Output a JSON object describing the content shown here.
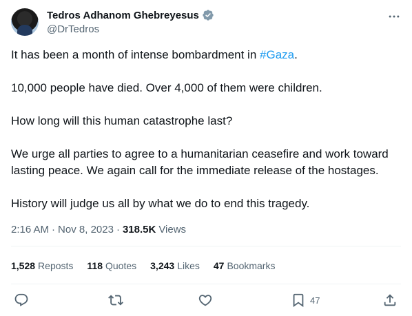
{
  "author": {
    "name": "Tedros Adhanom Ghebreyesus",
    "handle": "@DrTedros"
  },
  "post": {
    "p1_pre": "It has been a month of intense bombardment in ",
    "p1_hashtag": "#Gaza",
    "p1_post": ".",
    "p2": "10,000 people have died. Over 4,000 of them were children.",
    "p3": "How long will this human catastrophe last?",
    "p4": "We urge all parties to agree to a humanitarian ceasefire and work toward lasting peace. We again call for the immediate release of the hostages.",
    "p5": "History will judge us all by what we do to end this tragedy."
  },
  "meta": {
    "time": "2:16 AM",
    "separator": "·",
    "date": "Nov 8, 2023",
    "views_count": "318.5K",
    "views_label": "Views"
  },
  "stats": {
    "reposts_count": "1,528",
    "reposts_label": "Reposts",
    "quotes_count": "118",
    "quotes_label": "Quotes",
    "likes_count": "3,243",
    "likes_label": "Likes",
    "bookmarks_count": "47",
    "bookmarks_label": "Bookmarks"
  },
  "actions": {
    "bookmark_count": "47"
  },
  "colors": {
    "accent": "#1d9bf0",
    "text": "#0f1419",
    "secondary": "#536471",
    "divider": "#eff3f4"
  }
}
